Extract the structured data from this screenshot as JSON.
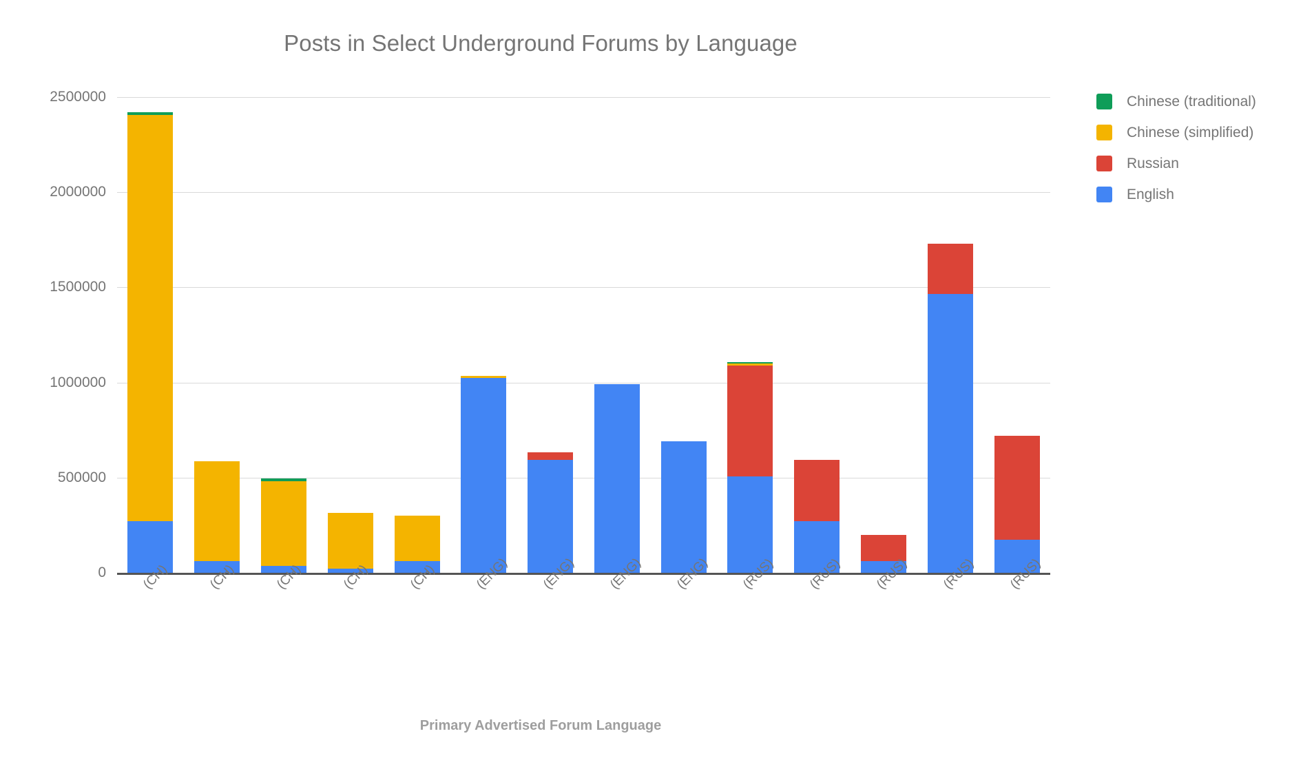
{
  "chart_data": {
    "type": "bar",
    "subtype": "stacked-vertical",
    "title": "Posts in Select Underground Forums by Language",
    "xlabel": "Primary Advertised Forum Language",
    "ylabel": "",
    "ylim": [
      0,
      2500000
    ],
    "yticks": [
      0,
      500000,
      1000000,
      1500000,
      2000000,
      2500000
    ],
    "ytick_labels": [
      "0",
      "500000",
      "1000000",
      "1500000",
      "2000000",
      "2500000"
    ],
    "grid": "horizontal",
    "legend_position": "right",
    "categories": [
      "(CH)",
      "(CH)",
      "(CH)",
      "(CH)",
      "(CH)",
      "(ENG)",
      "(ENG)",
      "(ENG)",
      "(ENG)",
      "(RUS)",
      "(RUS)",
      "(RUS)",
      "(RUS)",
      "(RUS)"
    ],
    "series": [
      {
        "name": "English",
        "color": "#4285f4",
        "values": [
          270000,
          60000,
          35000,
          20000,
          60000,
          1025000,
          595000,
          990000,
          690000,
          505000,
          270000,
          60000,
          1465000,
          175000
        ]
      },
      {
        "name": "Russian",
        "color": "#db4437",
        "values": [
          0,
          0,
          0,
          0,
          0,
          0,
          40000,
          0,
          0,
          585000,
          325000,
          140000,
          265000,
          545000
        ]
      },
      {
        "name": "Chinese (simplified)",
        "color": "#f4b400",
        "values": [
          2135000,
          525000,
          445000,
          295000,
          240000,
          10000,
          0,
          0,
          0,
          10000,
          0,
          0,
          0,
          0
        ]
      },
      {
        "name": "Chinese (traditional)",
        "color": "#0f9d58",
        "values": [
          15000,
          0,
          15000,
          0,
          0,
          0,
          0,
          0,
          0,
          3000,
          0,
          0,
          0,
          0
        ]
      }
    ],
    "totals": [
      2420000,
      585000,
      495000,
      315000,
      300000,
      1035000,
      635000,
      990000,
      690000,
      1103000,
      595000,
      200000,
      1730000,
      720000
    ]
  },
  "legend": {
    "items": [
      {
        "label": "Chinese (traditional)",
        "color": "#0f9d58"
      },
      {
        "label": "Chinese (simplified)",
        "color": "#f4b400"
      },
      {
        "label": "Russian",
        "color": "#db4437"
      },
      {
        "label": "English",
        "color": "#4285f4"
      }
    ]
  }
}
